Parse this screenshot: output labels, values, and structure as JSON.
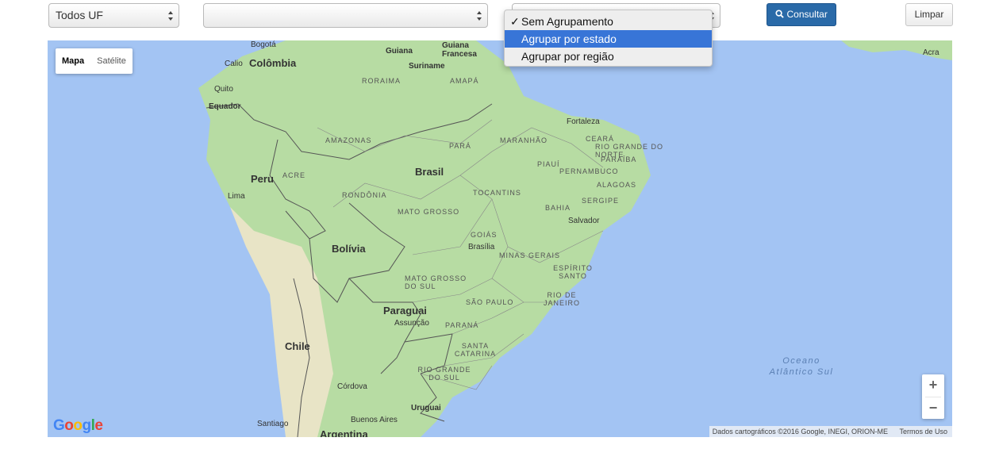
{
  "filters": {
    "uf_value": "Todos UF",
    "second_value": "",
    "grouping_options": [
      "Sem Agrupamento",
      "Agrupar por estado",
      "Agrupar por região"
    ],
    "grouping_selected_index": 0,
    "grouping_highlight_index": 1,
    "check_mark": "✓"
  },
  "buttons": {
    "consult_label": "Consultar",
    "clear_label": "Limpar"
  },
  "map": {
    "type_tabs": [
      "Mapa",
      "Satélite"
    ],
    "zoom_in": "+",
    "zoom_out": "−",
    "attribution": "Dados cartográficos ©2016 Google, INEGI, ORION-ME",
    "terms": "Termos de Uso",
    "logo": "Google",
    "countries": [
      "Colômbia",
      "Brasil",
      "Peru",
      "Bolívia",
      "Paraguai",
      "Chile",
      "Argentina",
      "Equador",
      "Uruguai",
      "Guiana",
      "Suriname",
      "Guiana Francesa"
    ],
    "cities": [
      "Bogotá",
      "Calio",
      "Quito",
      "Lima",
      "Fortaleza",
      "Salvador",
      "Brasília",
      "Assunção",
      "Córdova",
      "Buenos Aires",
      "Santiago",
      "Acra"
    ],
    "states": [
      "RORAIMA",
      "AMAPÁ",
      "AMAZONAS",
      "PARÁ",
      "MARANHÃO",
      "CEARÁ",
      "RIO GRANDE DO NORTE",
      "PIAUÍ",
      "PARAÍBA",
      "PERNAMBUCO",
      "ALAGOAS",
      "ACRE",
      "RONDÔNIA",
      "TOCANTINS",
      "SERGIPE",
      "BAHIA",
      "MATO GROSSO",
      "GOIÁS",
      "MINAS GERAIS",
      "ESPÍRITO SANTO",
      "MATO GROSSO DO SUL",
      "SÃO PAULO",
      "RIO DE JANEIRO",
      "PARANÁ",
      "SANTA CATARINA",
      "RIO GRANDE DO SUL"
    ],
    "ocean": "Oceano Atlântico Sul",
    "colors": {
      "water": "#a3c4f3",
      "land": "#b7dca3",
      "land_dry": "#e8e4c6",
      "border": "#555555"
    }
  }
}
